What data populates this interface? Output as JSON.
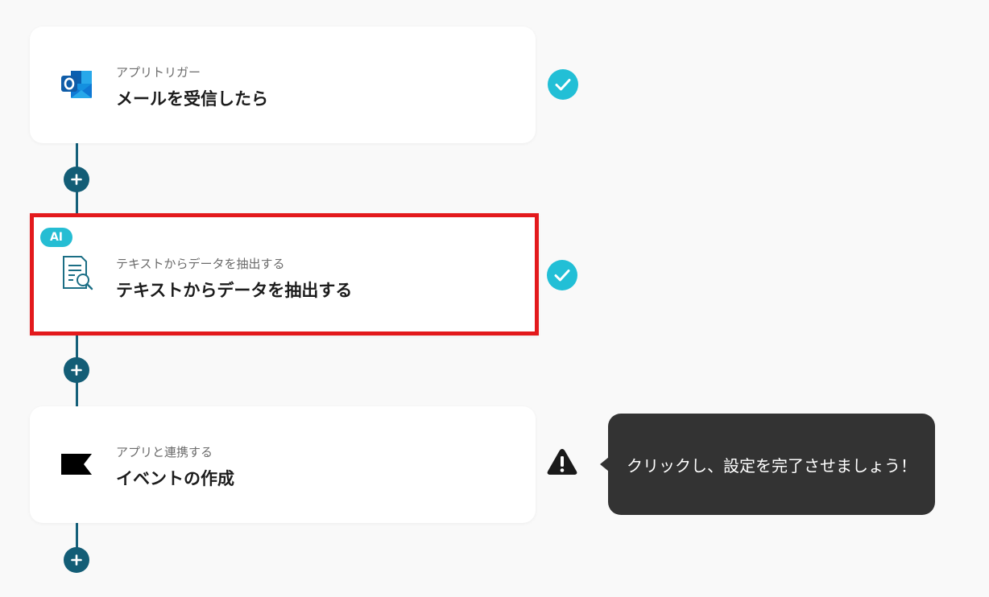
{
  "steps": [
    {
      "category": "アプリトリガー",
      "title": "メールを受信したら",
      "icon": "outlook-icon",
      "status": "complete"
    },
    {
      "badge": "AI",
      "category": "テキストからデータを抽出する",
      "title": "テキストからデータを抽出する",
      "icon": "document-search-icon",
      "status": "complete",
      "selected": true
    },
    {
      "category": "アプリと連携する",
      "title": "イベントの作成",
      "icon": "black-flag-icon",
      "status": "warning"
    }
  ],
  "tooltip": {
    "text": "クリックし、設定を完了させましょう！"
  },
  "colors": {
    "flow_line": "#15607a",
    "add_button": "#135d76",
    "check": "#22bfd6",
    "selected_border": "#e3191c",
    "ai_badge": "#25bdd3",
    "tooltip_bg": "#333333"
  }
}
